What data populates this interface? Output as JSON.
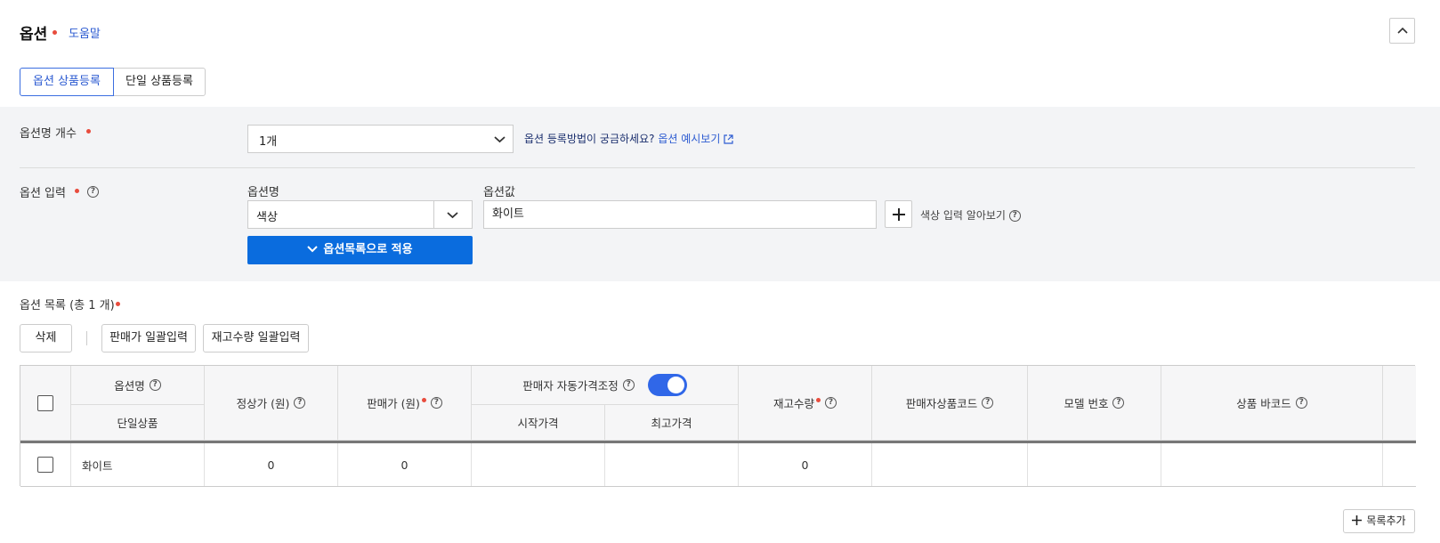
{
  "header": {
    "title": "옵션",
    "help_link": "도움말"
  },
  "tabs": [
    {
      "label": "옵션 상품등록",
      "active": true
    },
    {
      "label": "단일 상품등록",
      "active": false
    }
  ],
  "option_count": {
    "label": "옵션명 개수",
    "selected": "1개",
    "guide_text": "옵션 등록방법이 궁금하세요?",
    "guide_link": "옵션 예시보기"
  },
  "option_input": {
    "label": "옵션 입력",
    "name_label": "옵션명",
    "value_label": "옵션값",
    "name_selected": "색상",
    "value": "화이트",
    "color_help": "색상 입력 알아보기",
    "apply_button": "옵션목록으로 적용"
  },
  "option_list": {
    "title": "옵션 목록 (총 1 개)",
    "buttons": {
      "delete": "삭제",
      "bulk_price": "판매가 일괄입력",
      "bulk_stock": "재고수량 일괄입력",
      "add_row": "목록추가"
    },
    "headers": {
      "option_name": "옵션명",
      "single_product": "단일상품",
      "regular_price": "정상가 (원)",
      "sale_price": "판매가 (원)",
      "auto_price": "판매자 자동가격조정",
      "start_price": "시작가격",
      "max_price": "최고가격",
      "stock": "재고수량",
      "seller_code": "판매자상품코드",
      "model_no": "모델 번호",
      "barcode": "상품 바코드"
    },
    "auto_price_enabled": true,
    "rows": [
      {
        "option_name": "화이트",
        "regular_price": "0",
        "sale_price": "0",
        "start_price": "",
        "max_price": "",
        "stock": "0",
        "seller_code": "",
        "model_no": "",
        "barcode": ""
      }
    ]
  },
  "colors": {
    "accent": "#0a6cde",
    "link": "#2c5bd1",
    "required": "#e84c3d",
    "panel_bg": "#f3f4f6",
    "toggle_on": "#3067e8"
  }
}
